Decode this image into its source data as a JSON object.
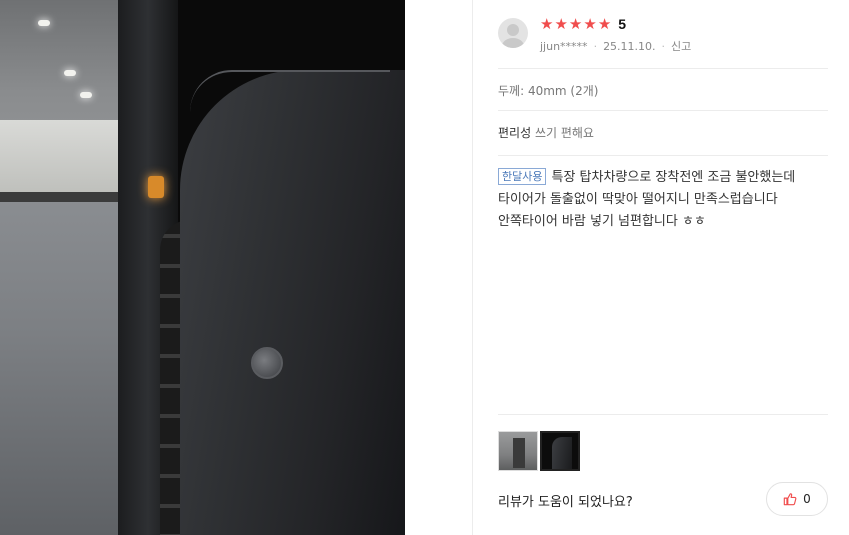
{
  "review": {
    "rating": "5",
    "stars": [
      "★",
      "★",
      "★",
      "★",
      "★"
    ],
    "star_color": "#f04d4d",
    "user": "jjun*****",
    "date": "25.11.10.",
    "report_label": "신고",
    "attributes": [
      {
        "key": "두께:",
        "value": "40mm (2개)"
      },
      {
        "key": "편리성",
        "value": "쓰기 편해요"
      }
    ],
    "badge": "한달사용",
    "text_lines": [
      "특장 탑차차량으로 장착전엔 조금 불안했는데",
      "타이어가 돌출없이 딱맞아 떨어지니 만족스럽습니다",
      "안쪽타이어 바람 넣기 넘편합니다 ㅎㅎ"
    ],
    "helpful_question": "리뷰가 도움이 되었나요?",
    "like_count": "0",
    "like_icon": "thumbs-up-icon"
  }
}
